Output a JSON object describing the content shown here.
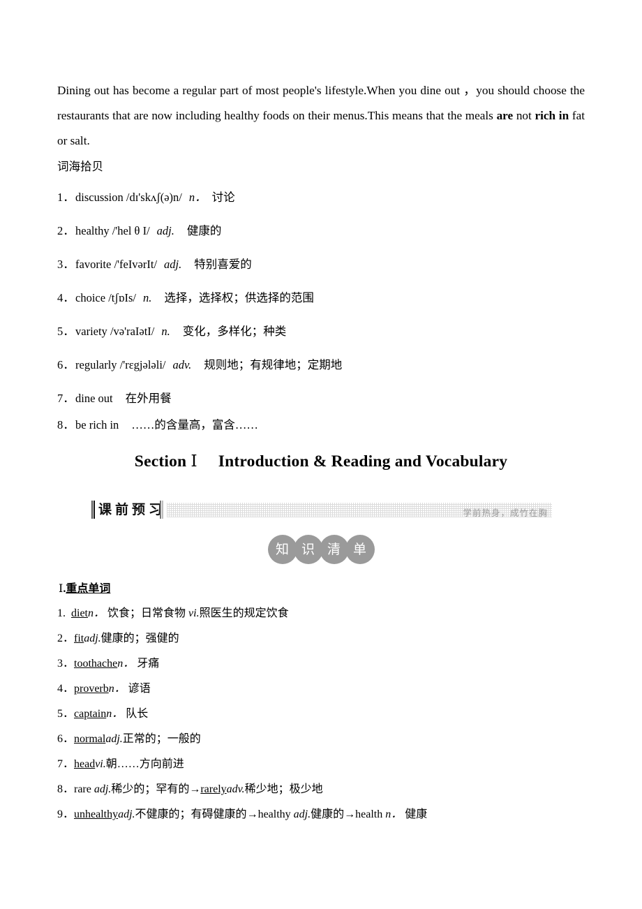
{
  "intro_paragraph": {
    "part1": "Dining out has become a regular part of most people's lifestyle.When you dine out ，you should choose the restaurants that are now including healthy foods on their menus.This means that the meals ",
    "bold1": "are",
    "mid1": " not ",
    "bold2": "rich in",
    "tail": " fat or salt."
  },
  "cihai": {
    "title": "词海拾贝",
    "items": [
      {
        "num": "1．",
        "word": "discussion",
        "ipa": "/dɪ'skʌʃ(ə)n/",
        "pos": "n．",
        "cn": "讨论"
      },
      {
        "num": "2．",
        "word": "healthy",
        "ipa": "/'hel θ I/",
        "pos": "adj.",
        "cn": "健康的"
      },
      {
        "num": "3．",
        "word": "favorite",
        "ipa": "/'feIvərIt/",
        "pos": "adj.",
        "cn": "特别喜爱的"
      },
      {
        "num": "4．",
        "word": "choice",
        "ipa": "/tʃɒIs/",
        "pos": "n.",
        "cn": "选择，选择权；供选择的范围"
      },
      {
        "num": "5．",
        "word": "variety",
        "ipa": "/və'raIətI/",
        "pos": "n.",
        "cn": "变化，多样化；种类"
      },
      {
        "num": "6．",
        "word": "regularly",
        "ipa": "/'rɛgjələli/",
        "pos": "adv.",
        "cn": "规则地；有规律地；定期地"
      },
      {
        "num": "7．",
        "word": "dine out",
        "ipa": "",
        "pos": "",
        "cn": "在外用餐"
      },
      {
        "num": "8．",
        "word": "be rich in",
        "ipa": "",
        "pos": "",
        "cn": "……的含量高，富含……"
      }
    ]
  },
  "section_heading": {
    "label": "Section",
    "roman": "Ⅰ",
    "title": "Introduction & Reading and Vocabulary"
  },
  "banner": {
    "label": "课前预习",
    "motto": "学前热身，成竹在胸"
  },
  "badges": {
    "chars": [
      "知",
      "识",
      "清",
      "单"
    ]
  },
  "keywords_section": {
    "roman": "Ⅰ",
    "dot": ".",
    "title": "重点单词",
    "items": [
      {
        "num": "1.",
        "word": "diet",
        "rest_pos": "n．",
        "rest": " 饮食；日常食物 ",
        "pos2": "vi.",
        "rest2": "照医生的规定饮食"
      },
      {
        "num": "2．",
        "word": "fit",
        "rest_pos": "adj.",
        "rest": "健康的；强健的",
        "pos2": "",
        "rest2": ""
      },
      {
        "num": "3．",
        "word": "toothache",
        "rest_pos": "n．",
        "rest": " 牙痛",
        "pos2": "",
        "rest2": ""
      },
      {
        "num": "4．",
        "word": "proverb",
        "rest_pos": "n．",
        "rest": " 谚语",
        "pos2": "",
        "rest2": ""
      },
      {
        "num": "5．",
        "word": "captain",
        "rest_pos": "n．",
        "rest": " 队长",
        "pos2": "",
        "rest2": ""
      },
      {
        "num": "6．",
        "word": "normal",
        "rest_pos": "adj.",
        "rest": "正常的；一般的",
        "pos2": "",
        "rest2": ""
      },
      {
        "num": "7．",
        "word": "head",
        "rest_pos": "vi.",
        "rest": "朝……方向前进",
        "pos2": "",
        "rest2": ""
      }
    ],
    "item8": {
      "num": "8．",
      "plain_word": "rare ",
      "pos1": "adj.",
      "cn1": "稀少的；罕有的",
      "arrow1": "→",
      "word2": "rarely",
      "pos2": "adv.",
      "cn2": "稀少地；极少地"
    },
    "item9": {
      "num": "9．",
      "word1": "unhealthy",
      "pos1": "adj.",
      "cn1": "不健康的；有碍健康的",
      "arrow1": "→",
      "word2": "healthy ",
      "pos2": "adj.",
      "cn2": "健康的",
      "arrow2": "→",
      "word3": "health ",
      "pos3": "n．",
      "cn3": " 健康"
    }
  }
}
